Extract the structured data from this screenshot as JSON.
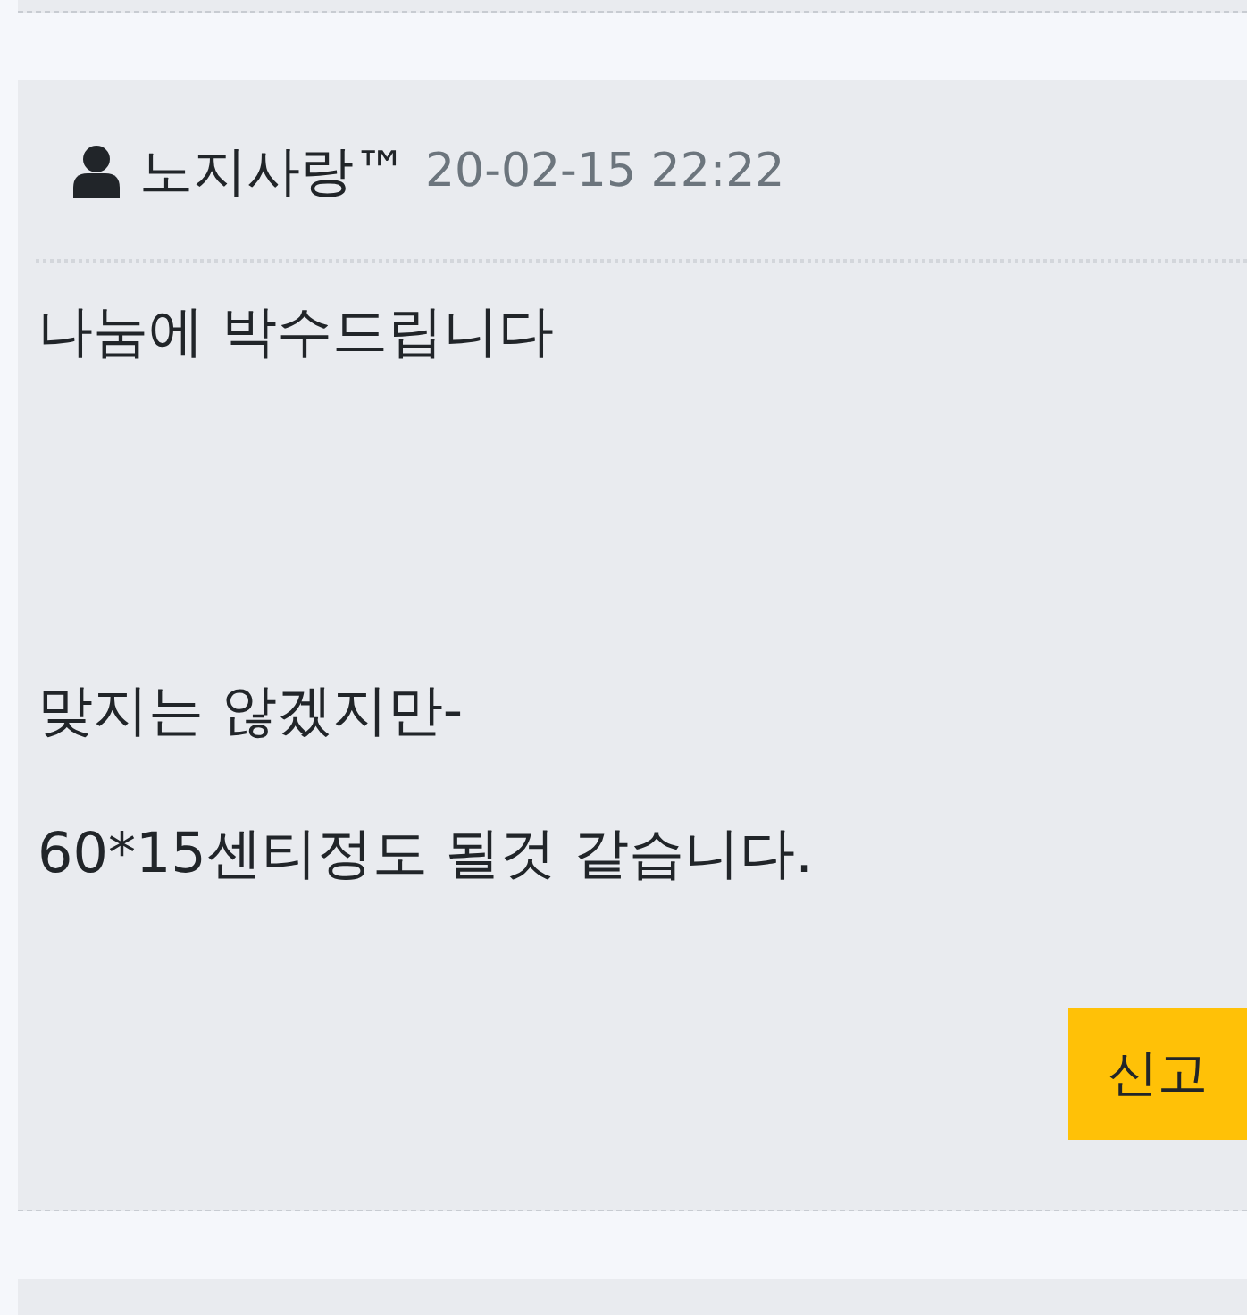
{
  "comment": {
    "author": "노지사랑™",
    "date": "20-02-15 22:22",
    "blocks": [
      [
        "나눔에 박수드립니다"
      ],
      [
        "맞지는 않겠지만-",
        "60*15센티정도 될것 같습니다."
      ]
    ],
    "report_button": "신고"
  }
}
